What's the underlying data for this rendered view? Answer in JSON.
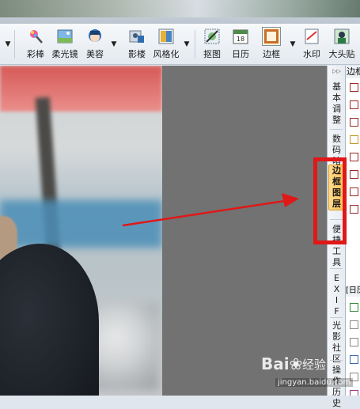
{
  "toolbar": {
    "buttons": [
      {
        "label": "彩棒",
        "icon": "magic-wand-icon"
      },
      {
        "label": "柔光镜",
        "icon": "soft-light-icon"
      },
      {
        "label": "美容",
        "icon": "beauty-icon"
      },
      {
        "label": "影楼",
        "icon": "studio-icon"
      },
      {
        "label": "风格化",
        "icon": "stylize-icon"
      },
      {
        "label": "抠图",
        "icon": "cutout-icon"
      },
      {
        "label": "日历",
        "icon": "calendar-icon",
        "icon_text": "18"
      },
      {
        "label": "边框",
        "icon": "frame-icon"
      },
      {
        "label": "水印",
        "icon": "watermark-icon"
      },
      {
        "label": "大头贴",
        "icon": "sticker-photo-icon"
      }
    ]
  },
  "vertical_tabs": [
    {
      "label": "基本调整",
      "selected": false
    },
    {
      "label": "数码暗房",
      "selected": false
    },
    {
      "label": "边框图层",
      "selected": true
    },
    {
      "label": "便捷工具",
      "selected": false
    },
    {
      "label": "EXIF",
      "selected": false
    },
    {
      "label": "光影社区",
      "selected": false
    },
    {
      "label": "操作历史",
      "selected": false
    }
  ],
  "side_panel": {
    "header": "边框",
    "sub_header": "[日历"
  },
  "watermark": {
    "brand": "Bai",
    "suffix": "经验",
    "url": "jingyan.baidu.com"
  },
  "colors": {
    "highlight": "#e01818",
    "selected_tab": "#ffc35a",
    "canvas_bg": "#727272"
  }
}
